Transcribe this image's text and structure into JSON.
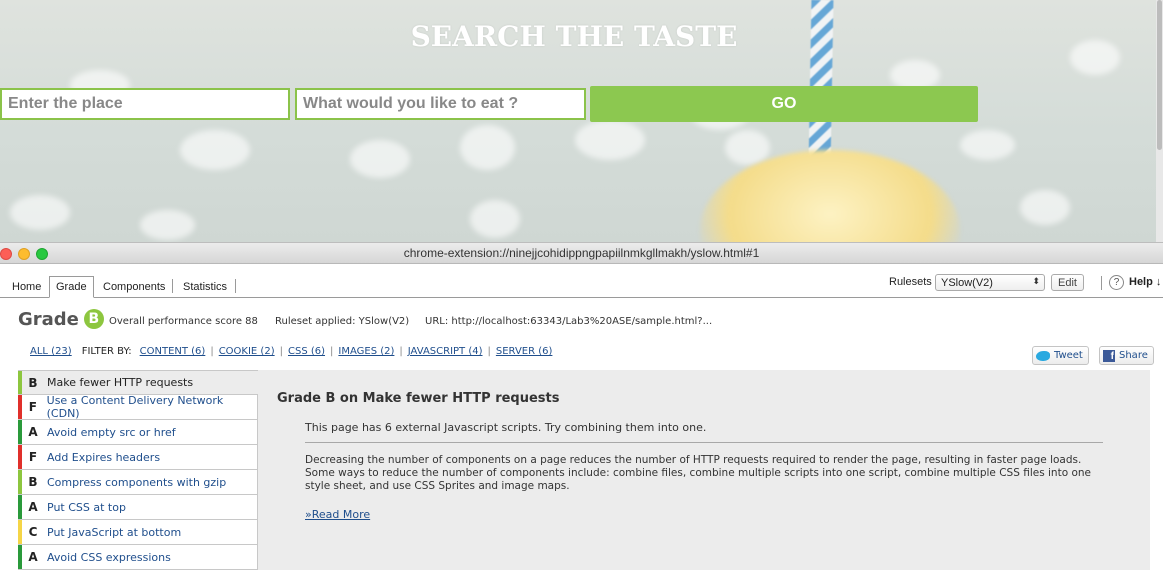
{
  "hero": {
    "title": "SEARCH THE TASTE",
    "place_placeholder": "Enter the place",
    "food_placeholder": "What would you like to eat ?",
    "go_label": "GO"
  },
  "window": {
    "title": "chrome-extension://ninejjcohidippngpapiilnmkgllmakh/yslow.html#1"
  },
  "tabs": [
    "Home",
    "Grade",
    "Components",
    "Statistics"
  ],
  "active_tab": "Grade",
  "toolbar": {
    "rulesets_label": "Rulesets",
    "ruleset_value": "YSlow(V2)",
    "edit_label": "Edit",
    "help_label": "Help ↓"
  },
  "grade": {
    "label": "Grade",
    "letter": "B",
    "overall": "Overall performance score 88",
    "ruleset": "Ruleset applied: YSlow(V2)",
    "url": "URL: http://localhost:63343/Lab3%20ASE/sample.html?..."
  },
  "filters": {
    "all": "ALL (23)",
    "filter_by": "FILTER BY:",
    "items": [
      "CONTENT (6)",
      "COOKIE (2)",
      "CSS (6)",
      "IMAGES (2)",
      "JAVASCRIPT (4)",
      "SERVER (6)"
    ]
  },
  "share": {
    "tweet": "Tweet",
    "share": "Share"
  },
  "rules": [
    {
      "grade": "B",
      "name": "Make fewer HTTP requests",
      "color": "#8dc63f"
    },
    {
      "grade": "F",
      "name": "Use a Content Delivery Network (CDN)",
      "color": "#e0302b"
    },
    {
      "grade": "A",
      "name": "Avoid empty src or href",
      "color": "#2a9a3b"
    },
    {
      "grade": "F",
      "name": "Add Expires headers",
      "color": "#e0302b"
    },
    {
      "grade": "B",
      "name": "Compress components with gzip",
      "color": "#8dc63f"
    },
    {
      "grade": "A",
      "name": "Put CSS at top",
      "color": "#2a9a3b"
    },
    {
      "grade": "C",
      "name": "Put JavaScript at bottom",
      "color": "#f5d547"
    },
    {
      "grade": "A",
      "name": "Avoid CSS expressions",
      "color": "#2a9a3b"
    }
  ],
  "detail": {
    "title": "Grade B on Make fewer HTTP requests",
    "summary": "This page has 6 external Javascript scripts. Try combining them into one.",
    "description": "Decreasing the number of components on a page reduces the number of HTTP requests required to render the page, resulting in faster page loads. Some ways to reduce the number of components include: combine files, combine multiple scripts into one script, combine multiple CSS files into one style sheet, and use CSS Sprites and image maps.",
    "read_more": "»Read More"
  }
}
